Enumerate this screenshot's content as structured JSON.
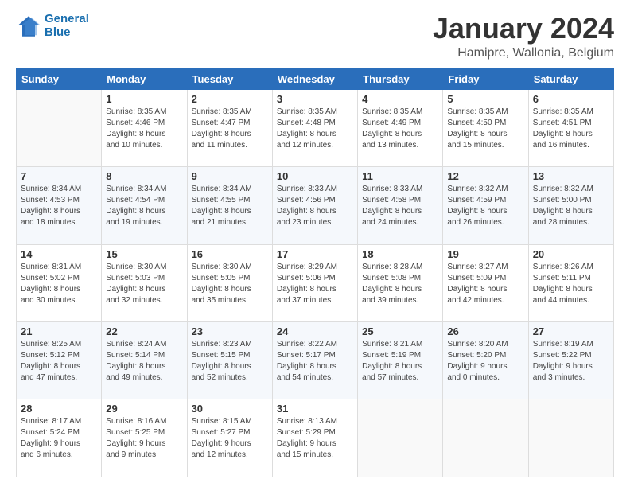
{
  "header": {
    "logo_line1": "General",
    "logo_line2": "Blue",
    "title": "January 2024",
    "subtitle": "Hamipre, Wallonia, Belgium"
  },
  "weekdays": [
    "Sunday",
    "Monday",
    "Tuesday",
    "Wednesday",
    "Thursday",
    "Friday",
    "Saturday"
  ],
  "weeks": [
    [
      {
        "day": "",
        "info": ""
      },
      {
        "day": "1",
        "info": "Sunrise: 8:35 AM\nSunset: 4:46 PM\nDaylight: 8 hours\nand 10 minutes."
      },
      {
        "day": "2",
        "info": "Sunrise: 8:35 AM\nSunset: 4:47 PM\nDaylight: 8 hours\nand 11 minutes."
      },
      {
        "day": "3",
        "info": "Sunrise: 8:35 AM\nSunset: 4:48 PM\nDaylight: 8 hours\nand 12 minutes."
      },
      {
        "day": "4",
        "info": "Sunrise: 8:35 AM\nSunset: 4:49 PM\nDaylight: 8 hours\nand 13 minutes."
      },
      {
        "day": "5",
        "info": "Sunrise: 8:35 AM\nSunset: 4:50 PM\nDaylight: 8 hours\nand 15 minutes."
      },
      {
        "day": "6",
        "info": "Sunrise: 8:35 AM\nSunset: 4:51 PM\nDaylight: 8 hours\nand 16 minutes."
      }
    ],
    [
      {
        "day": "7",
        "info": "Sunrise: 8:34 AM\nSunset: 4:53 PM\nDaylight: 8 hours\nand 18 minutes."
      },
      {
        "day": "8",
        "info": "Sunrise: 8:34 AM\nSunset: 4:54 PM\nDaylight: 8 hours\nand 19 minutes."
      },
      {
        "day": "9",
        "info": "Sunrise: 8:34 AM\nSunset: 4:55 PM\nDaylight: 8 hours\nand 21 minutes."
      },
      {
        "day": "10",
        "info": "Sunrise: 8:33 AM\nSunset: 4:56 PM\nDaylight: 8 hours\nand 23 minutes."
      },
      {
        "day": "11",
        "info": "Sunrise: 8:33 AM\nSunset: 4:58 PM\nDaylight: 8 hours\nand 24 minutes."
      },
      {
        "day": "12",
        "info": "Sunrise: 8:32 AM\nSunset: 4:59 PM\nDaylight: 8 hours\nand 26 minutes."
      },
      {
        "day": "13",
        "info": "Sunrise: 8:32 AM\nSunset: 5:00 PM\nDaylight: 8 hours\nand 28 minutes."
      }
    ],
    [
      {
        "day": "14",
        "info": "Sunrise: 8:31 AM\nSunset: 5:02 PM\nDaylight: 8 hours\nand 30 minutes."
      },
      {
        "day": "15",
        "info": "Sunrise: 8:30 AM\nSunset: 5:03 PM\nDaylight: 8 hours\nand 32 minutes."
      },
      {
        "day": "16",
        "info": "Sunrise: 8:30 AM\nSunset: 5:05 PM\nDaylight: 8 hours\nand 35 minutes."
      },
      {
        "day": "17",
        "info": "Sunrise: 8:29 AM\nSunset: 5:06 PM\nDaylight: 8 hours\nand 37 minutes."
      },
      {
        "day": "18",
        "info": "Sunrise: 8:28 AM\nSunset: 5:08 PM\nDaylight: 8 hours\nand 39 minutes."
      },
      {
        "day": "19",
        "info": "Sunrise: 8:27 AM\nSunset: 5:09 PM\nDaylight: 8 hours\nand 42 minutes."
      },
      {
        "day": "20",
        "info": "Sunrise: 8:26 AM\nSunset: 5:11 PM\nDaylight: 8 hours\nand 44 minutes."
      }
    ],
    [
      {
        "day": "21",
        "info": "Sunrise: 8:25 AM\nSunset: 5:12 PM\nDaylight: 8 hours\nand 47 minutes."
      },
      {
        "day": "22",
        "info": "Sunrise: 8:24 AM\nSunset: 5:14 PM\nDaylight: 8 hours\nand 49 minutes."
      },
      {
        "day": "23",
        "info": "Sunrise: 8:23 AM\nSunset: 5:15 PM\nDaylight: 8 hours\nand 52 minutes."
      },
      {
        "day": "24",
        "info": "Sunrise: 8:22 AM\nSunset: 5:17 PM\nDaylight: 8 hours\nand 54 minutes."
      },
      {
        "day": "25",
        "info": "Sunrise: 8:21 AM\nSunset: 5:19 PM\nDaylight: 8 hours\nand 57 minutes."
      },
      {
        "day": "26",
        "info": "Sunrise: 8:20 AM\nSunset: 5:20 PM\nDaylight: 9 hours\nand 0 minutes."
      },
      {
        "day": "27",
        "info": "Sunrise: 8:19 AM\nSunset: 5:22 PM\nDaylight: 9 hours\nand 3 minutes."
      }
    ],
    [
      {
        "day": "28",
        "info": "Sunrise: 8:17 AM\nSunset: 5:24 PM\nDaylight: 9 hours\nand 6 minutes."
      },
      {
        "day": "29",
        "info": "Sunrise: 8:16 AM\nSunset: 5:25 PM\nDaylight: 9 hours\nand 9 minutes."
      },
      {
        "day": "30",
        "info": "Sunrise: 8:15 AM\nSunset: 5:27 PM\nDaylight: 9 hours\nand 12 minutes."
      },
      {
        "day": "31",
        "info": "Sunrise: 8:13 AM\nSunset: 5:29 PM\nDaylight: 9 hours\nand 15 minutes."
      },
      {
        "day": "",
        "info": ""
      },
      {
        "day": "",
        "info": ""
      },
      {
        "day": "",
        "info": ""
      }
    ]
  ]
}
